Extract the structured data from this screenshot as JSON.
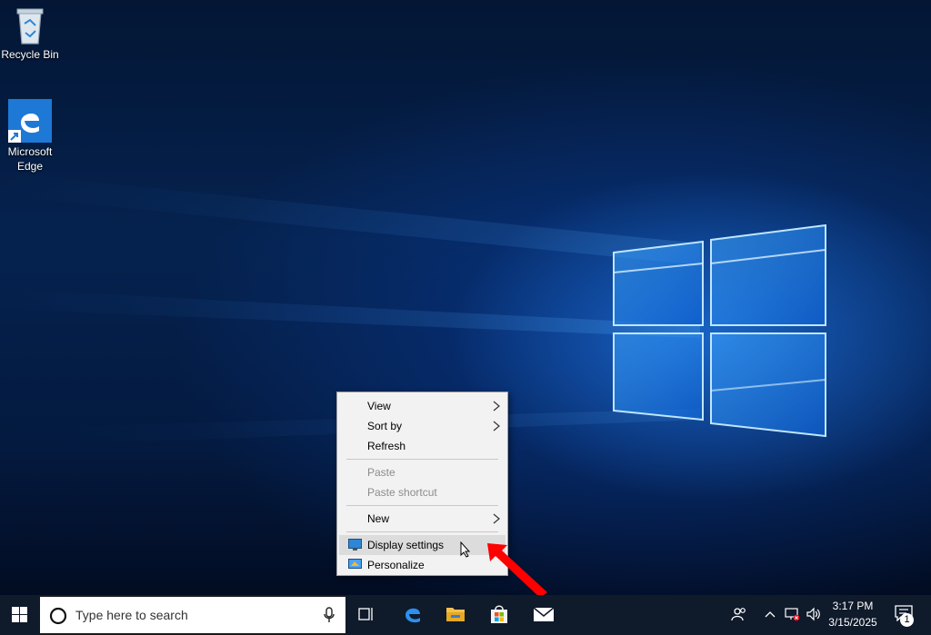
{
  "desktop": {
    "icons": [
      {
        "label": "Recycle Bin",
        "icon": "recycle-bin-icon"
      },
      {
        "label": "Microsoft Edge",
        "label_line1": "Microsoft",
        "label_line2": "Edge",
        "icon": "edge-icon"
      }
    ]
  },
  "context_menu": {
    "items": [
      {
        "label": "View",
        "has_submenu": true,
        "enabled": true
      },
      {
        "label": "Sort by",
        "has_submenu": true,
        "enabled": true
      },
      {
        "label": "Refresh",
        "enabled": true
      },
      {
        "label": "Paste",
        "enabled": false
      },
      {
        "label": "Paste shortcut",
        "enabled": false
      },
      {
        "label": "New",
        "has_submenu": true,
        "enabled": true
      },
      {
        "label": "Display settings",
        "enabled": true,
        "highlighted": true,
        "icon": "display-settings-icon"
      },
      {
        "label": "Personalize",
        "enabled": true,
        "icon": "personalize-icon"
      }
    ]
  },
  "taskbar": {
    "search_placeholder": "Type here to search",
    "pinned": [
      "task-view-icon",
      "edge-icon",
      "file-explorer-icon",
      "store-icon",
      "mail-icon"
    ],
    "tray": {
      "time": "3:17 PM",
      "date": "3/15/2025",
      "notification_count": "1"
    }
  },
  "colors": {
    "accent": "#0078d7",
    "menu_background": "#f2f2f2",
    "menu_highlight": "#dcdcdc",
    "taskbar": "#0f1a2b",
    "annotation_arrow": "#ff0000"
  }
}
